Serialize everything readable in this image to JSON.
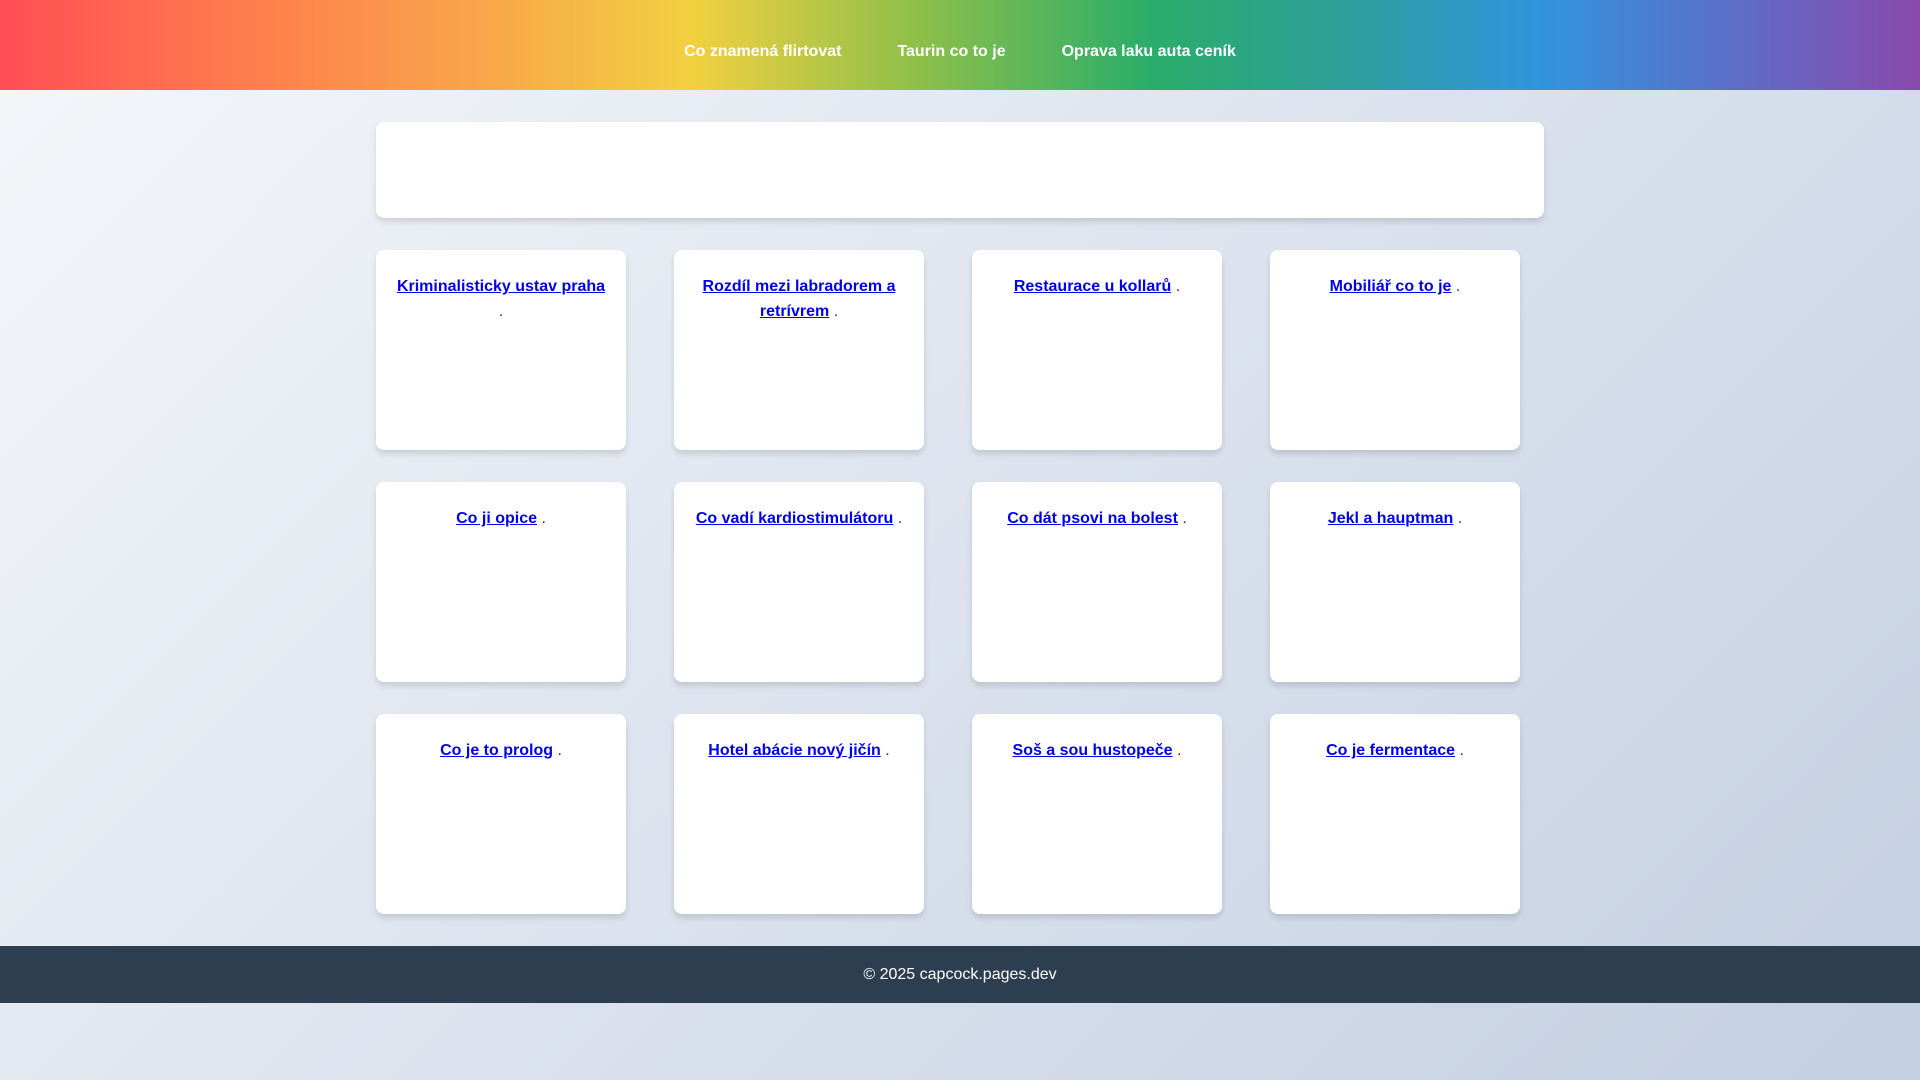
{
  "nav": {
    "items": [
      {
        "label": "Co znamená flirtovat"
      },
      {
        "label": "Taurin co to je"
      },
      {
        "label": "Oprava laku auta ceník"
      }
    ]
  },
  "cards": [
    {
      "link": "Kriminalisticky ustav praha",
      "suffix": "."
    },
    {
      "link": "Rozdíl mezi labradorem a retrívrem",
      "suffix": "."
    },
    {
      "link": "Restaurace u kollarů",
      "suffix": "."
    },
    {
      "link": "Mobiliář co to je",
      "suffix": "."
    },
    {
      "link": "Co ji opice",
      "suffix": "."
    },
    {
      "link": "Co vadí kardiostimulátoru",
      "suffix": "."
    },
    {
      "link": "Co dát psovi na bolest",
      "suffix": "."
    },
    {
      "link": "Jekl a hauptman",
      "suffix": "."
    },
    {
      "link": "Co je to prolog",
      "suffix": "."
    },
    {
      "link": "Hotel abácie nový jičín",
      "suffix": "."
    },
    {
      "link": "Soš a sou hustopeče",
      "suffix": "."
    },
    {
      "link": "Co je fermentace",
      "suffix": "."
    }
  ],
  "footer": {
    "text": "© 2025 capcock.pages.dev"
  }
}
